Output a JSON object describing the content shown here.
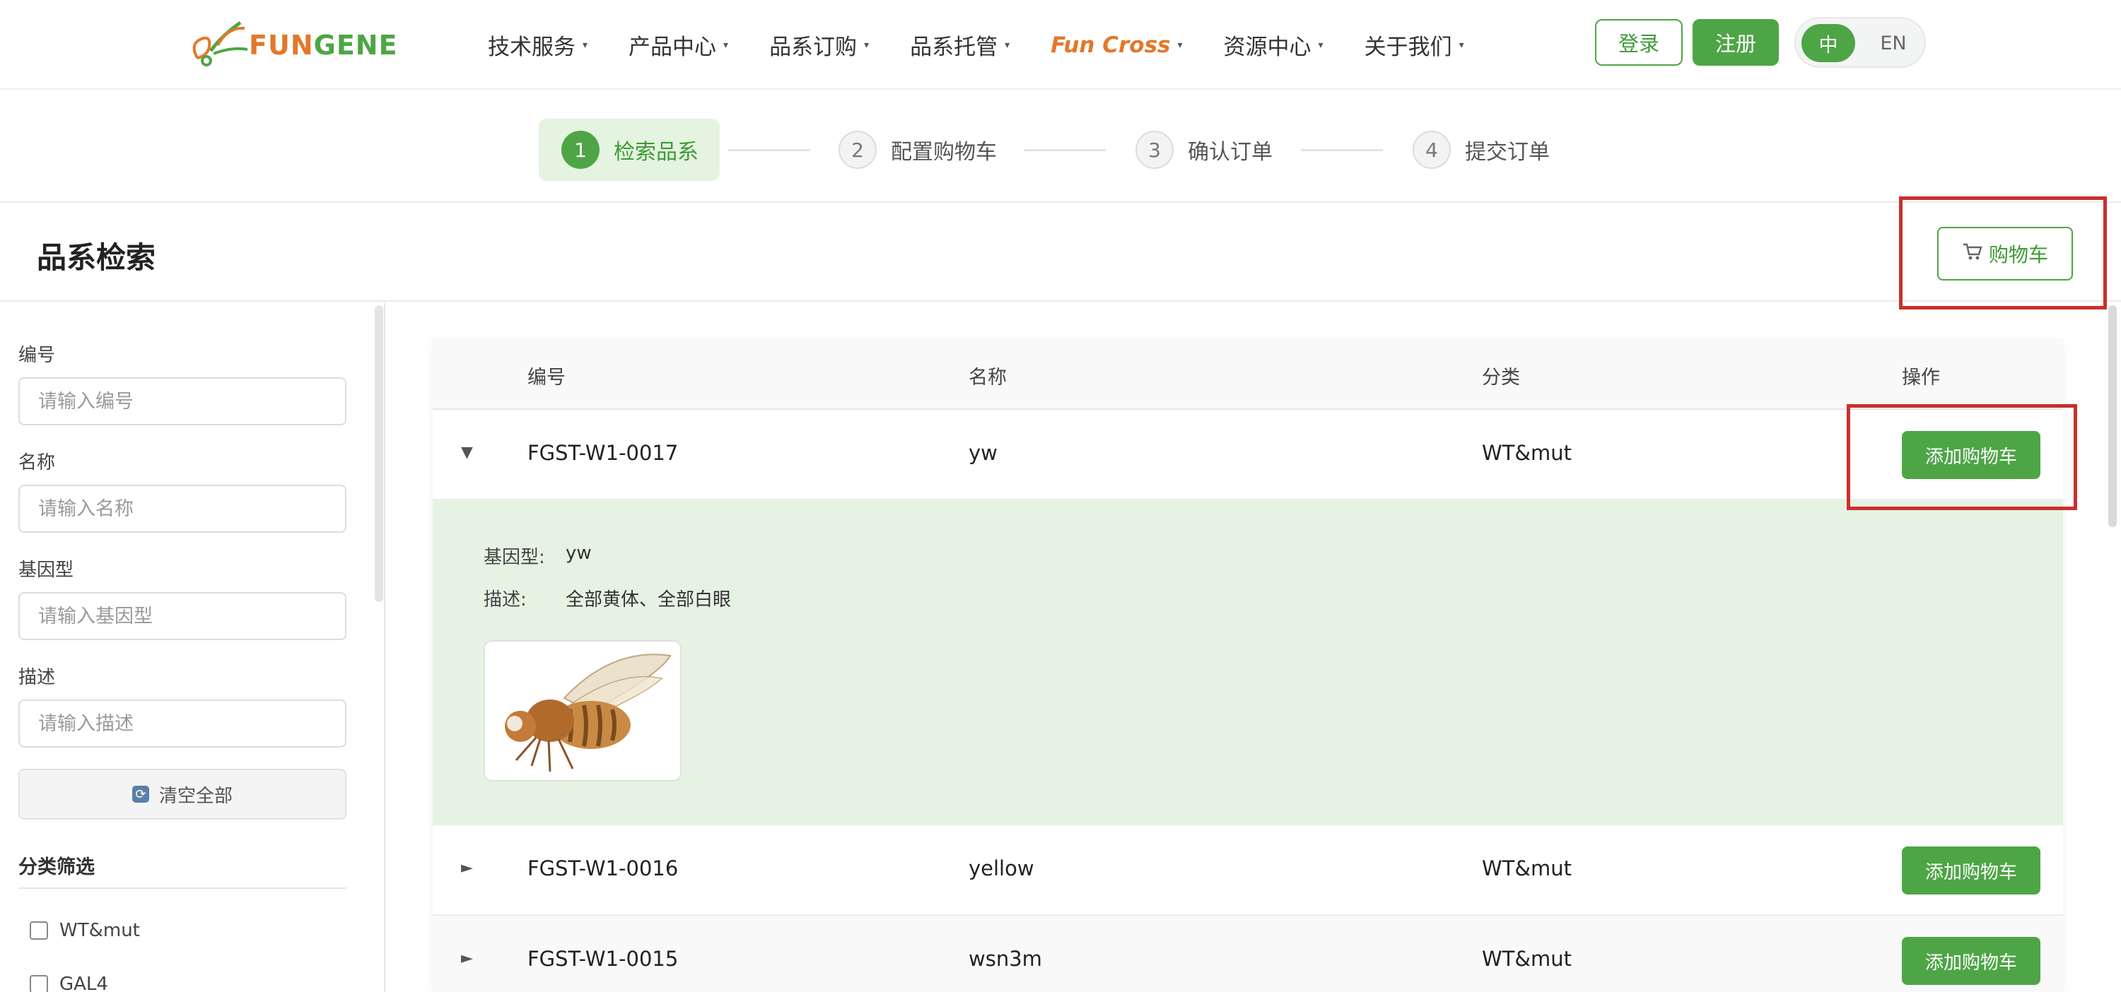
{
  "header": {
    "logo_text": "FUNGENE",
    "nav": [
      {
        "label": "技术服务"
      },
      {
        "label": "产品中心"
      },
      {
        "label": "品系订购"
      },
      {
        "label": "品系托管"
      },
      {
        "label": "Fun Cross"
      },
      {
        "label": "资源中心"
      },
      {
        "label": "关于我们"
      }
    ],
    "login_label": "登录",
    "register_label": "注册",
    "lang_zh": "中",
    "lang_en": "EN",
    "colors": {
      "brand_green": "#4ea546",
      "brand_orange": "#e2782b"
    }
  },
  "steps": [
    {
      "num": "1",
      "label": "检索品系",
      "active": true
    },
    {
      "num": "2",
      "label": "配置购物车",
      "active": false
    },
    {
      "num": "3",
      "label": "确认订单",
      "active": false
    },
    {
      "num": "4",
      "label": "提交订单",
      "active": false
    }
  ],
  "page": {
    "title": "品系检索",
    "cart_label": "购物车",
    "cart_icon": "cart-icon"
  },
  "sidebar": {
    "fields": [
      {
        "label": "编号",
        "placeholder": "请输入编号"
      },
      {
        "label": "名称",
        "placeholder": "请输入名称"
      },
      {
        "label": "基因型",
        "placeholder": "请输入基因型"
      },
      {
        "label": "描述",
        "placeholder": "请输入描述"
      }
    ],
    "clear_label": "清空全部",
    "filter_title": "分类筛选",
    "filters": [
      "WT&mut",
      "GAL4"
    ]
  },
  "table": {
    "headers": {
      "id": "编号",
      "name": "名称",
      "category": "分类",
      "action": "操作"
    },
    "add_label": "添加购物车",
    "rows": [
      {
        "id": "FGST-W1-0017",
        "name": "yw",
        "category": "WT&mut",
        "expanded": true,
        "toggle": "▼"
      },
      {
        "id": "FGST-W1-0016",
        "name": "yellow",
        "category": "WT&mut",
        "expanded": false,
        "toggle": "►"
      },
      {
        "id": "FGST-W1-0015",
        "name": "wsn3m",
        "category": "WT&mut",
        "expanded": false,
        "toggle": "►"
      }
    ],
    "detail": {
      "genotype_label": "基因型:",
      "genotype": "yw",
      "desc_label": "描述:",
      "desc": "全部黄体、全部白眼"
    }
  }
}
